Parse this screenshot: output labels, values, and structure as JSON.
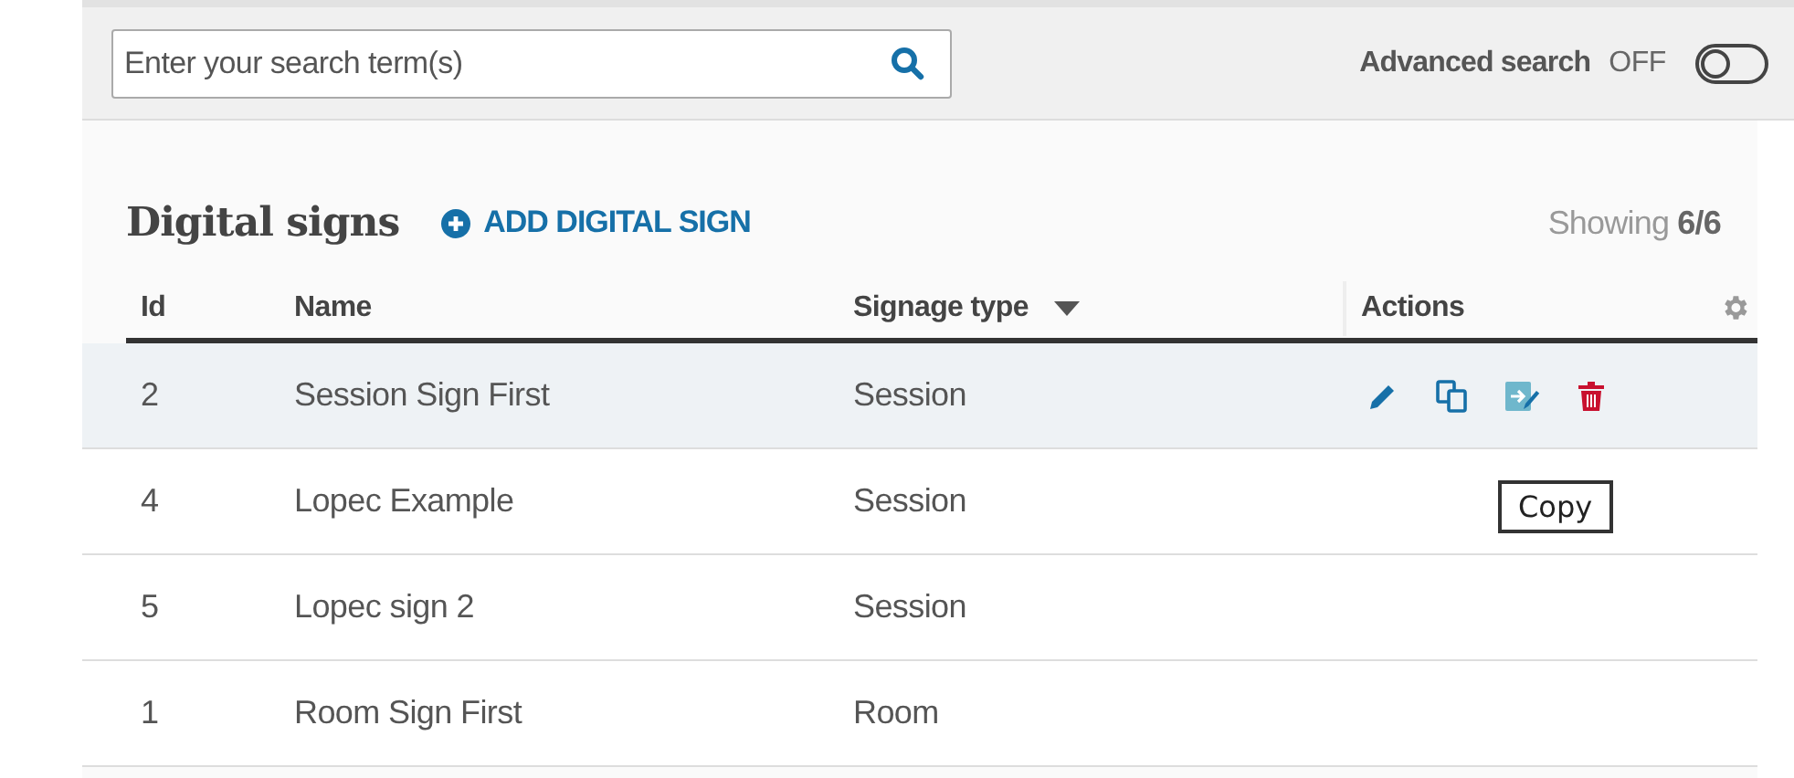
{
  "search": {
    "placeholder": "Enter your search term(s)"
  },
  "advanced_search": {
    "label": "Advanced search",
    "state": "OFF",
    "on": false
  },
  "title": "Digital signs",
  "add_button": "ADD DIGITAL SIGN",
  "showing": "Showing **6/6**",
  "table": {
    "columns": [
      {
        "label": "Id",
        "sorted": false
      },
      {
        "label": "Name",
        "sorted": false
      },
      {
        "label": "Signage type",
        "sorted": true
      },
      {
        "label": "Actions",
        "sorted": false
      }
    ],
    "rows": [
      {
        "cells": [
          "2",
          "Session Sign First",
          "Session"
        ],
        "highlighted": true,
        "actions": [
          {
            "kind": "edit"
          },
          {
            "kind": "copy"
          },
          {
            "kind": "assign"
          },
          {
            "kind": "delete"
          }
        ]
      },
      {
        "cells": [
          "4",
          "Lopec Example",
          "Session"
        ],
        "highlighted": false,
        "actions": []
      },
      {
        "cells": [
          "5",
          "Lopec sign 2",
          "Session"
        ],
        "highlighted": false,
        "actions": []
      },
      {
        "cells": [
          "1",
          "Room Sign First",
          "Room"
        ],
        "highlighted": false,
        "actions": []
      }
    ]
  },
  "tooltip": "Copy"
}
